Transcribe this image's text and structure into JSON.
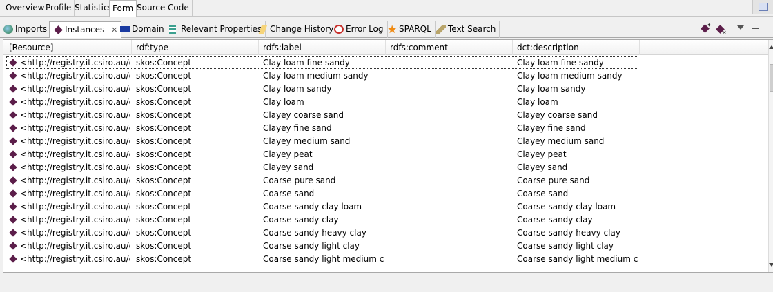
{
  "editor_tabs": [
    {
      "label": "Overview",
      "active": false
    },
    {
      "label": "Profile",
      "active": false
    },
    {
      "label": "Statistics",
      "active": false
    },
    {
      "label": "Form",
      "active": true
    },
    {
      "label": "Source Code",
      "active": false
    }
  ],
  "view_tabs": [
    {
      "label": "Imports",
      "icon": "globe-icon"
    },
    {
      "label": "Instances",
      "icon": "instance-diamond-icon",
      "active": true,
      "closable": true
    },
    {
      "label": "Domain",
      "icon": "domain-icon"
    },
    {
      "label": "Relevant Properties",
      "icon": "properties-icon"
    },
    {
      "label": "Change History",
      "icon": "history-icon"
    },
    {
      "label": "Error Log",
      "icon": "error-log-icon"
    },
    {
      "label": "SPARQL",
      "icon": "star-icon"
    },
    {
      "label": "Text Search",
      "icon": "search-icon"
    }
  ],
  "table": {
    "columns": [
      "[Resource]",
      "rdf:type",
      "rdfs:label",
      "rdfs:comment",
      "dct:description"
    ],
    "selected_row": 0,
    "rows": [
      {
        "resource": "<http://registry.it.csiro.au/d...",
        "type": "skos:Concept",
        "label": "Clay loam fine sandy",
        "comment": "",
        "description": "Clay loam fine sandy"
      },
      {
        "resource": "<http://registry.it.csiro.au/d...",
        "type": "skos:Concept",
        "label": "Clay loam medium sandy",
        "comment": "",
        "description": "Clay loam medium sandy"
      },
      {
        "resource": "<http://registry.it.csiro.au/d...",
        "type": "skos:Concept",
        "label": "Clay loam sandy",
        "comment": "",
        "description": "Clay loam sandy"
      },
      {
        "resource": "<http://registry.it.csiro.au/d...",
        "type": "skos:Concept",
        "label": "Clay loam",
        "comment": "",
        "description": "Clay loam"
      },
      {
        "resource": "<http://registry.it.csiro.au/d...",
        "type": "skos:Concept",
        "label": "Clayey coarse sand",
        "comment": "",
        "description": "Clayey coarse sand"
      },
      {
        "resource": "<http://registry.it.csiro.au/d...",
        "type": "skos:Concept",
        "label": "Clayey fine sand",
        "comment": "",
        "description": "Clayey fine sand"
      },
      {
        "resource": "<http://registry.it.csiro.au/d...",
        "type": "skos:Concept",
        "label": "Clayey medium sand",
        "comment": "",
        "description": "Clayey medium sand"
      },
      {
        "resource": "<http://registry.it.csiro.au/d...",
        "type": "skos:Concept",
        "label": "Clayey peat",
        "comment": "",
        "description": "Clayey peat"
      },
      {
        "resource": "<http://registry.it.csiro.au/d...",
        "type": "skos:Concept",
        "label": "Clayey sand",
        "comment": "",
        "description": "Clayey sand"
      },
      {
        "resource": "<http://registry.it.csiro.au/d...",
        "type": "skos:Concept",
        "label": "Coarse pure sand",
        "comment": "",
        "description": "Coarse pure sand"
      },
      {
        "resource": "<http://registry.it.csiro.au/d...",
        "type": "skos:Concept",
        "label": "Coarse sand",
        "comment": "",
        "description": "Coarse sand"
      },
      {
        "resource": "<http://registry.it.csiro.au/d...",
        "type": "skos:Concept",
        "label": "Coarse sandy clay loam",
        "comment": "",
        "description": "Coarse sandy clay loam"
      },
      {
        "resource": "<http://registry.it.csiro.au/d...",
        "type": "skos:Concept",
        "label": "Coarse sandy clay",
        "comment": "",
        "description": "Coarse sandy clay"
      },
      {
        "resource": "<http://registry.it.csiro.au/d...",
        "type": "skos:Concept",
        "label": "Coarse sandy heavy clay",
        "comment": "",
        "description": "Coarse sandy heavy clay"
      },
      {
        "resource": "<http://registry.it.csiro.au/d...",
        "type": "skos:Concept",
        "label": "Coarse sandy light clay",
        "comment": "",
        "description": "Coarse sandy light clay"
      },
      {
        "resource": "<http://registry.it.csiro.au/d...",
        "type": "skos:Concept",
        "label": "Coarse sandy light medium clay",
        "comment": "",
        "description": "Coarse sandy light medium clay"
      }
    ]
  },
  "icons": {
    "toolbar": [
      "create-instance-icon",
      "delete-instance-icon",
      "view-menu-icon",
      "minimize-icon"
    ],
    "instance_color": "#5c1e4a"
  }
}
